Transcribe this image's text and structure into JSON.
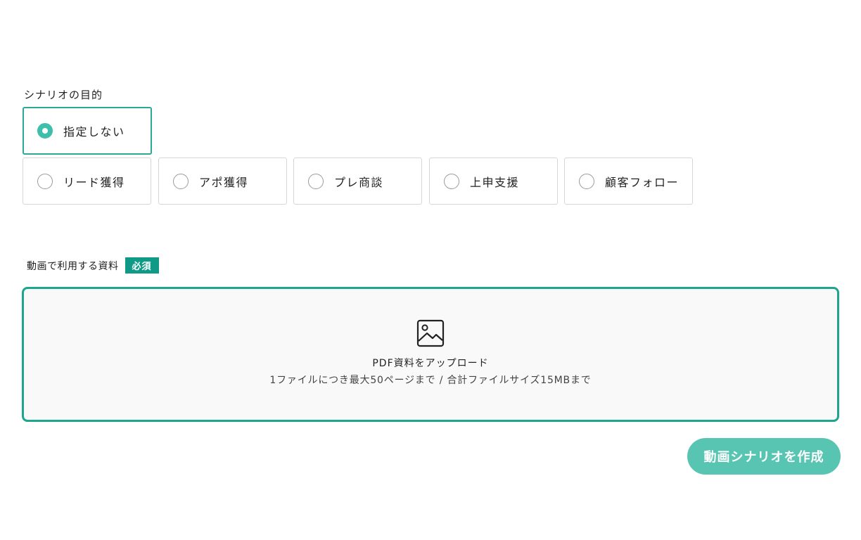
{
  "scenario": {
    "label": "シナリオの目的",
    "options": [
      {
        "label": "指定しない",
        "selected": true
      },
      {
        "label": "リード獲得",
        "selected": false
      },
      {
        "label": "アポ獲得",
        "selected": false
      },
      {
        "label": "プレ商談",
        "selected": false
      },
      {
        "label": "上申支援",
        "selected": false
      },
      {
        "label": "顧客フォロー",
        "selected": false
      }
    ]
  },
  "upload": {
    "label": "動画で利用する資料",
    "required_badge": "必須",
    "icon": "image-icon",
    "title": "PDF資料をアップロード",
    "subtitle": "1ファイルにつき最大50ページまで / 合計ファイルサイズ15MBまで"
  },
  "actions": {
    "create_label": "動画シナリオを作成"
  },
  "colors": {
    "accent": "#1ea58f",
    "radio_checked": "#3dbfac",
    "badge": "#0f9a87",
    "button": "#58c5b3"
  }
}
